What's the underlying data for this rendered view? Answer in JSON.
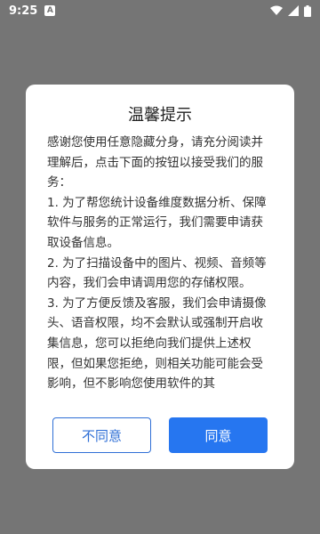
{
  "status_bar": {
    "time": "9:25",
    "notif_letter": "A",
    "icons": [
      "wifi-icon",
      "signal-icon",
      "battery-icon"
    ]
  },
  "dialog": {
    "title": "温馨提示",
    "paragraphs": [
      "感谢您使用任意隐藏分身，请充分阅读并理解后，点击下面的按钮以接受我们的服务：",
      "1. 为了帮您统计设备维度数据分析、保障软件与服务的正常运行，我们需要申请获取设备信息。",
      "2. 为了扫描设备中的图片、视频、音频等内容，我们会申请调用您的存储权限。",
      "3. 为了方便反馈及客服，我们会申请摄像头、语音权限，均不会默认或强制开启收集信息，您可以拒绝向我们提供上述权限，但如果您拒绝，则相关功能可能会受影响，但不影响您使用软件的其"
    ],
    "disagree_label": "不同意",
    "agree_label": "同意"
  },
  "colors": {
    "overlay": "#757575",
    "primary": "#2676f0",
    "dialog_bg": "#ffffff"
  }
}
